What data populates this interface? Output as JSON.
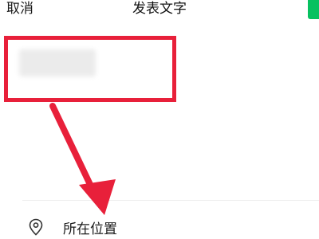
{
  "header": {
    "cancel_label": "取消",
    "title": "发表文字",
    "publish_color": "#07c160"
  },
  "composer": {
    "text_state": "blurred"
  },
  "location": {
    "label": "所在位置",
    "icon": "location-pin-icon"
  },
  "annotations": {
    "highlight_color": "#e8203a",
    "arrow_color": "#e8203a"
  }
}
